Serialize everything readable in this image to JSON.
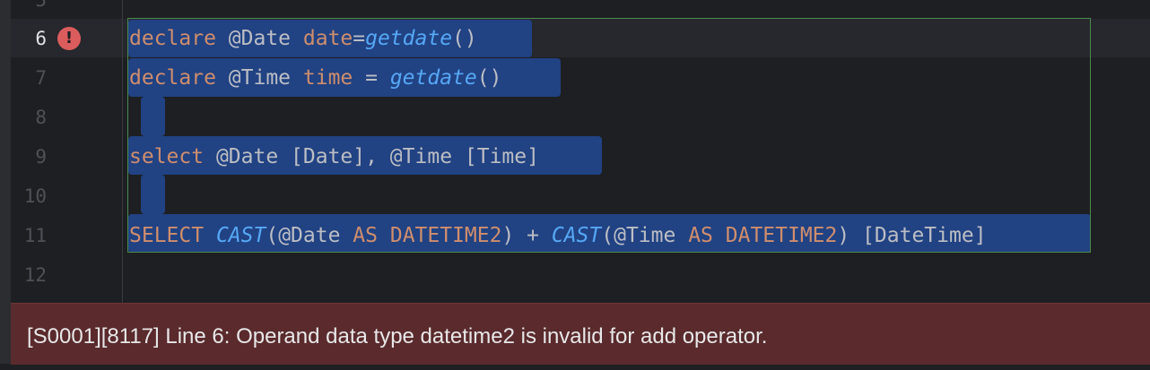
{
  "gutter": {
    "partial_top": "5",
    "lines": [
      "6",
      "7",
      "8",
      "9",
      "10",
      "11",
      "12"
    ]
  },
  "code": {
    "line6": {
      "kw1": "declare",
      "var": " @Date ",
      "kw2": "date",
      "op": "=",
      "fn": "getdate",
      "rest": "()"
    },
    "line7": {
      "kw1": "declare",
      "var": " @Time ",
      "kw2": "time",
      "op": " = ",
      "fn": "getdate",
      "rest": "()"
    },
    "line9": {
      "kw1": "select",
      "rest": " @Date [Date], @Time [Time]"
    },
    "line11": {
      "kw1": "SELECT",
      "sp1": " ",
      "fn1": "CAST",
      "t1": "(@Date ",
      "kw2": "AS",
      "t2": " ",
      "kw3": "DATETIME2",
      "t3": ") + ",
      "fn2": "CAST",
      "t4": "(@Time ",
      "kw4": "AS",
      "t5": " ",
      "kw5": "DATETIME2",
      "t6": ") [DateTime]"
    }
  },
  "error": {
    "message": "[S0001][8117] Line 6: Operand data type datetime2 is invalid for add operator.",
    "icon": "error-icon",
    "icon_glyph": "!"
  },
  "colors": {
    "keyword": "#cf8e6d",
    "function": "#56a8f5",
    "selection": "#214283",
    "error_bar": "#5a2a2d"
  }
}
